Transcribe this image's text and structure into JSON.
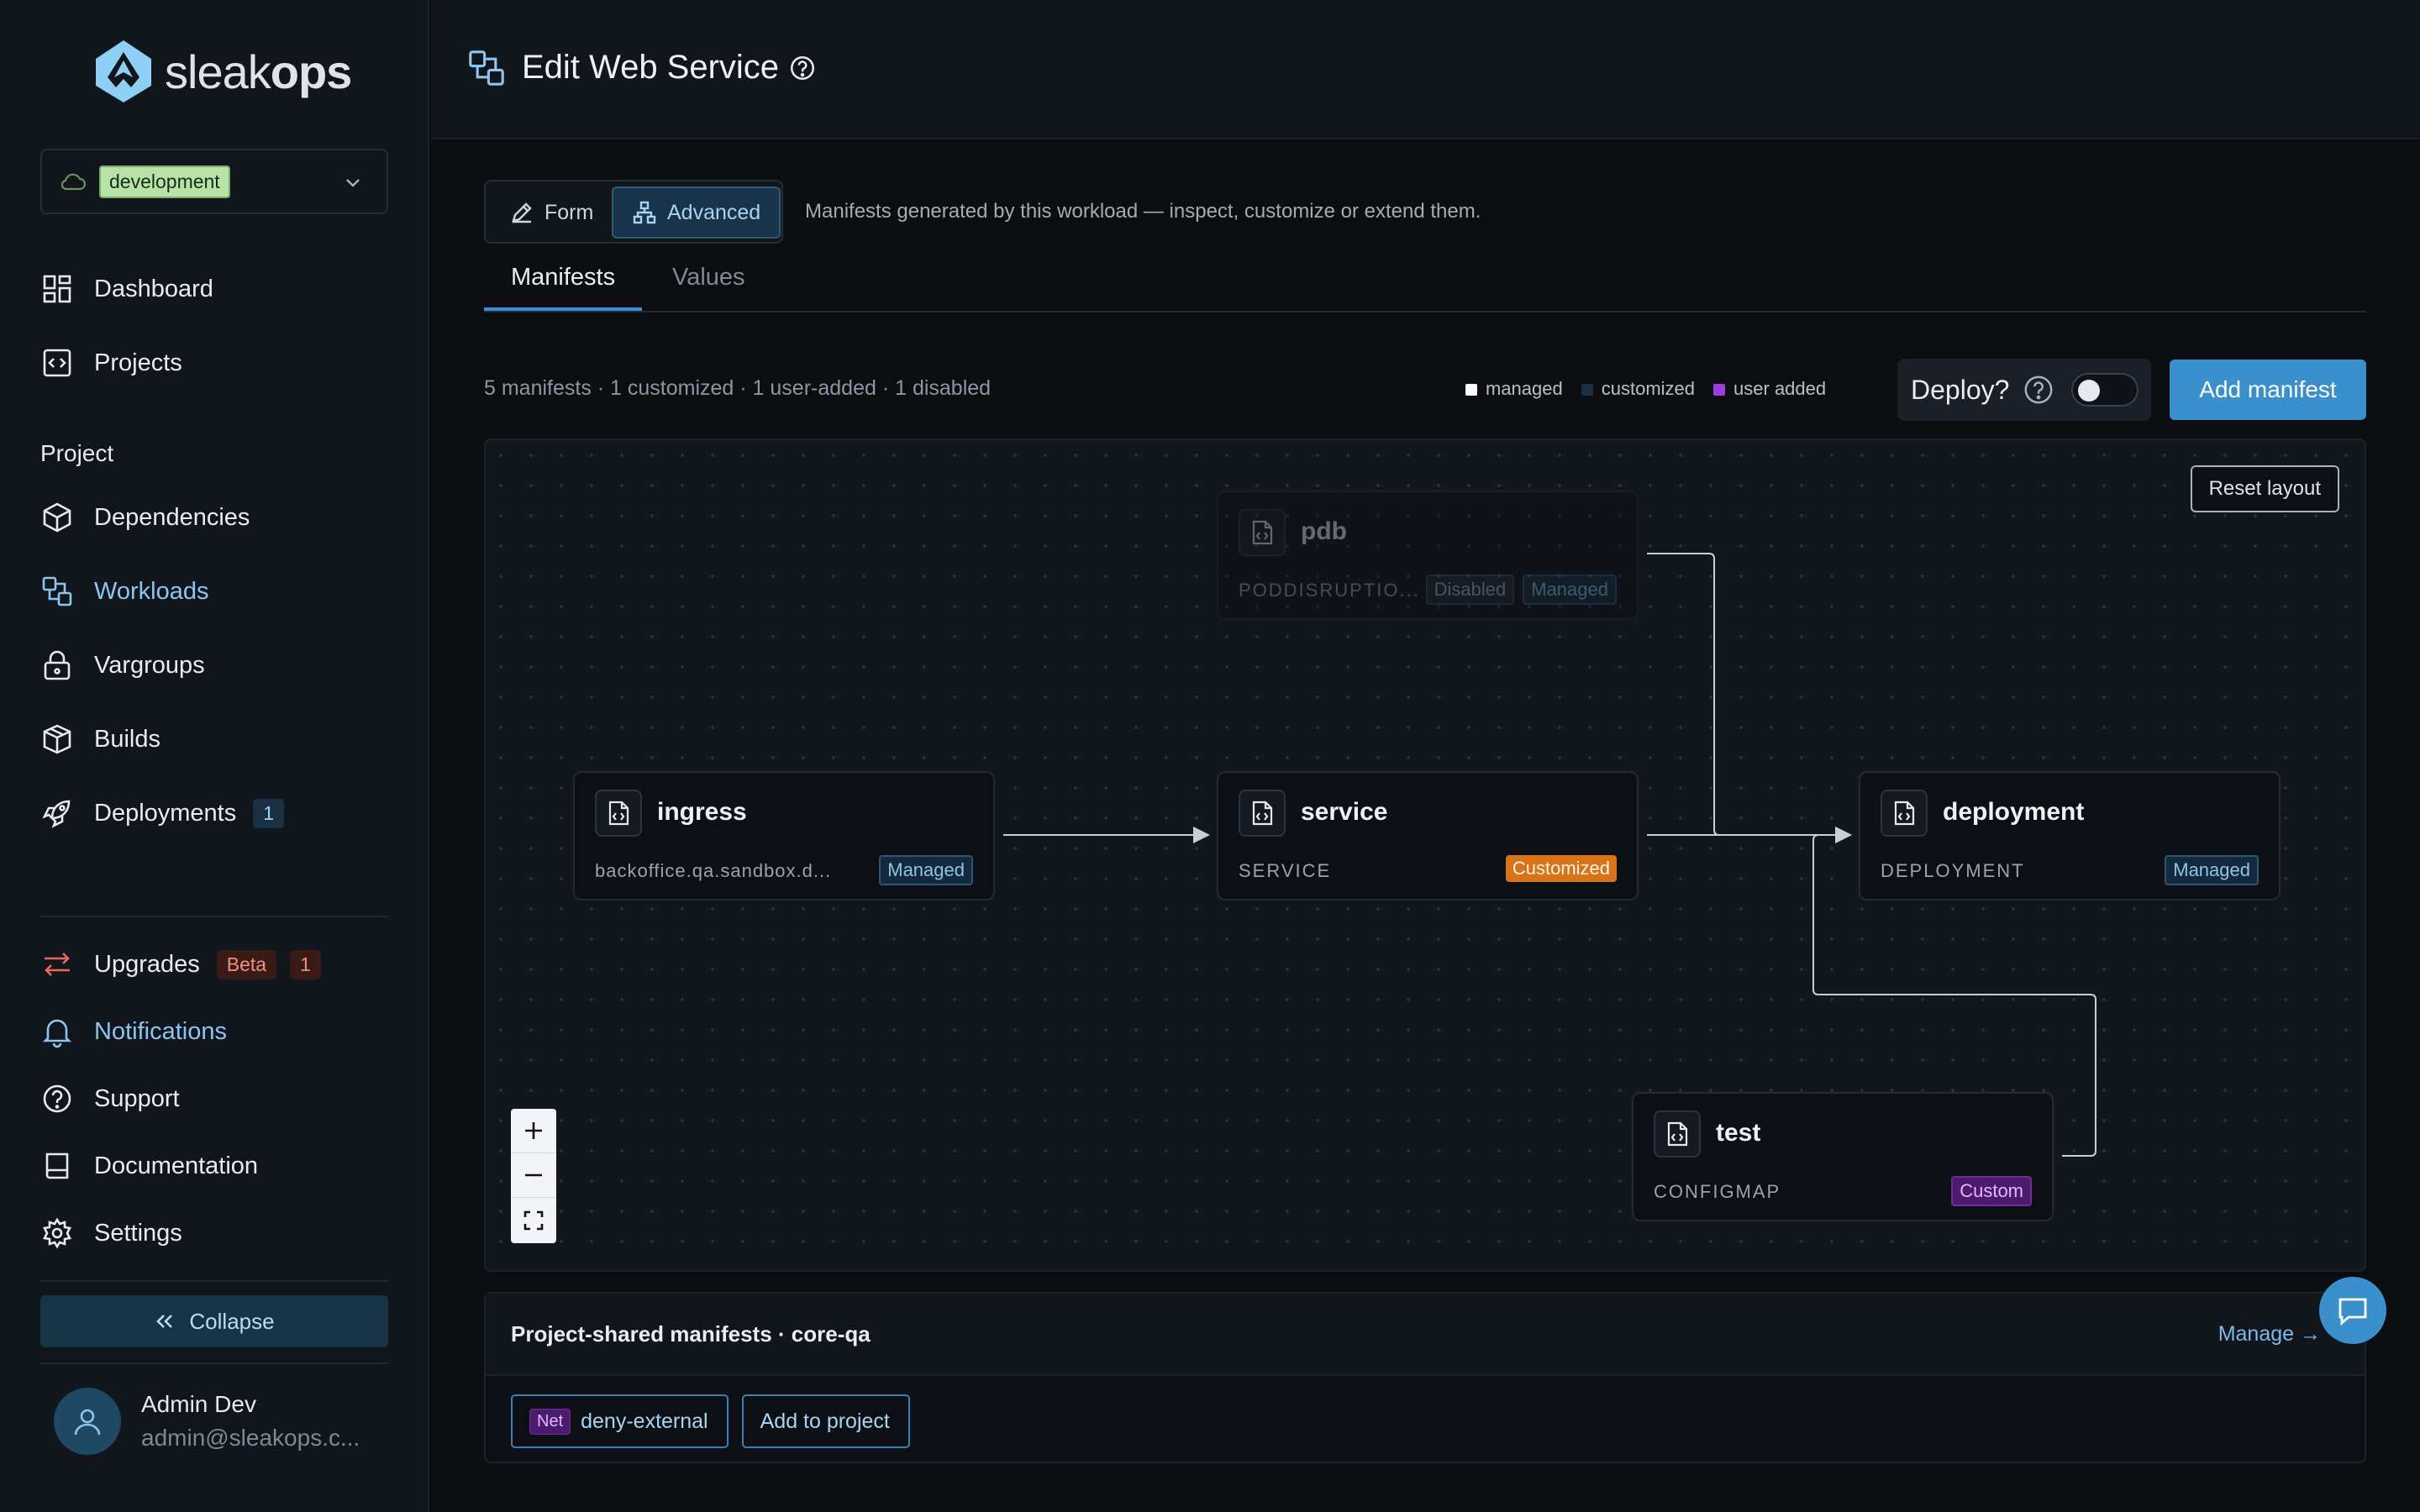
{
  "brand": {
    "name_light": "sleak",
    "name_bold": "ops"
  },
  "env": {
    "selected": "development"
  },
  "nav": {
    "dashboard": "Dashboard",
    "projects": "Projects",
    "section_project": "Project",
    "dependencies": "Dependencies",
    "workloads": "Workloads",
    "vargroups": "Vargroups",
    "builds": "Builds",
    "deployments": "Deployments",
    "deployments_count": "1",
    "upgrades": "Upgrades",
    "upgrades_badge": "Beta",
    "upgrades_count": "1",
    "notifications": "Notifications",
    "support": "Support",
    "documentation": "Documentation",
    "settings": "Settings",
    "collapse": "Collapse"
  },
  "user": {
    "name": "Admin Dev",
    "email": "admin@sleakops.c..."
  },
  "header": {
    "title": "Edit Web Service"
  },
  "mode": {
    "form": "Form",
    "advanced": "Advanced",
    "description": "Manifests generated by this workload — inspect, customize or extend them."
  },
  "tabs": {
    "manifests": "Manifests",
    "values": "Values"
  },
  "summary": "5 manifests · 1 customized · 1 user-added · 1 disabled",
  "legend": {
    "managed": "managed",
    "customized": "customized",
    "user_added": "user added",
    "colors": {
      "managed": "#ffffff",
      "customized": "#1e2f3f",
      "user_added": "#9b3fe0"
    }
  },
  "deploy": {
    "label": "Deploy?",
    "enabled": false
  },
  "add_manifest": "Add manifest",
  "canvas": {
    "reset_layout": "Reset layout",
    "nodes": {
      "pdb": {
        "title": "pdb",
        "kind": "PODDISRUPTIO...",
        "badges": [
          "Disabled",
          "Managed"
        ]
      },
      "ingress": {
        "title": "ingress",
        "kind": "backoffice.qa.sandbox.d...",
        "badge": "Managed"
      },
      "service": {
        "title": "service",
        "kind": "SERVICE",
        "badge": "Customized"
      },
      "deployment": {
        "title": "deployment",
        "kind": "DEPLOYMENT",
        "badge": "Managed"
      },
      "test": {
        "title": "test",
        "kind": "CONFIGMAP",
        "badge": "Custom"
      }
    }
  },
  "shared": {
    "title": "Project-shared manifests · core-qa",
    "manage": "Manage →",
    "item_tag": "Net",
    "item_name": "deny-external",
    "add_to_project": "Add to project"
  }
}
